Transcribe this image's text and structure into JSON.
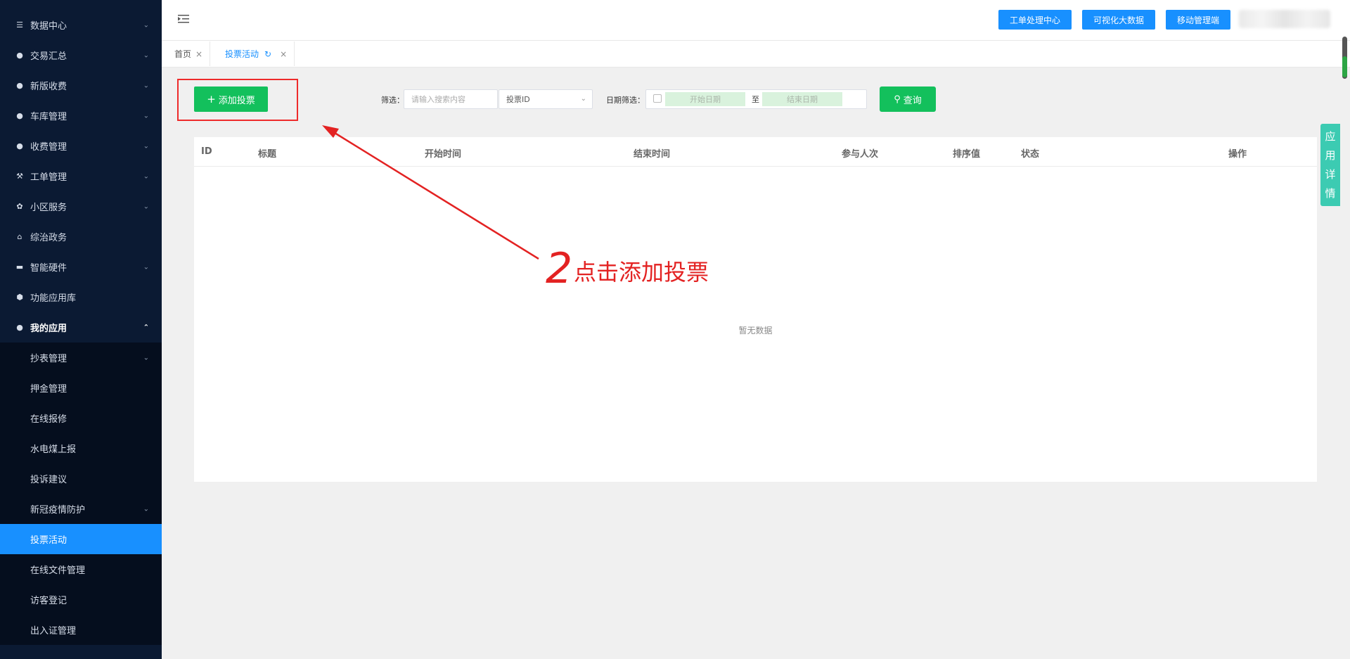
{
  "sidebar": {
    "items": [
      {
        "label": "数据中心",
        "icon": "database-icon"
      },
      {
        "label": "交易汇总",
        "icon": "money-bag-icon"
      },
      {
        "label": "新版收费",
        "icon": "coins-icon"
      },
      {
        "label": "车库管理",
        "icon": "car-icon"
      },
      {
        "label": "收费管理",
        "icon": "money-bag-icon"
      },
      {
        "label": "工单管理",
        "icon": "wrench-icon"
      },
      {
        "label": "小区服务",
        "icon": "flower-icon"
      },
      {
        "label": "综治政务",
        "icon": "bank-icon"
      },
      {
        "label": "智能硬件",
        "icon": "device-icon"
      },
      {
        "label": "功能应用库",
        "icon": "cube-icon"
      },
      {
        "label": "我的应用",
        "icon": "user-icon"
      }
    ],
    "my_apps_sub": [
      {
        "label": "抄表管理"
      },
      {
        "label": "押金管理"
      },
      {
        "label": "在线报修"
      },
      {
        "label": "水电煤上报"
      },
      {
        "label": "投诉建议"
      },
      {
        "label": "新冠疫情防护"
      },
      {
        "label": "投票活动"
      },
      {
        "label": "在线文件管理"
      },
      {
        "label": "访客登记"
      },
      {
        "label": "出入证管理"
      }
    ]
  },
  "header": {
    "buttons": [
      "工单处理中心",
      "可视化大数据",
      "移动管理端"
    ]
  },
  "tabs": {
    "home": "首页",
    "current": "投票活动"
  },
  "toolbar": {
    "add_label": "添加投票",
    "filter_label": "筛选：",
    "search_placeholder": "请输入搜索内容",
    "select_value": "投票ID",
    "date_label": "日期筛选：",
    "start_placeholder": "开始日期",
    "date_sep": "至",
    "end_placeholder": "结束日期",
    "query_label": "查询"
  },
  "table": {
    "columns": [
      "ID",
      "标题",
      "开始时间",
      "结束时间",
      "参与人次",
      "排序值",
      "状态",
      "操作"
    ],
    "empty_text": "暂无数据"
  },
  "side_tab": [
    "应",
    "用",
    "详",
    "情"
  ],
  "annotation": {
    "number": "2",
    "text": "点击添加投票",
    "color": "#e32222"
  },
  "colors": {
    "sidebar_bg": "#0b1a33",
    "primary": "#1890ff",
    "success": "#13c05c",
    "side_tab": "#3ccbb2"
  }
}
